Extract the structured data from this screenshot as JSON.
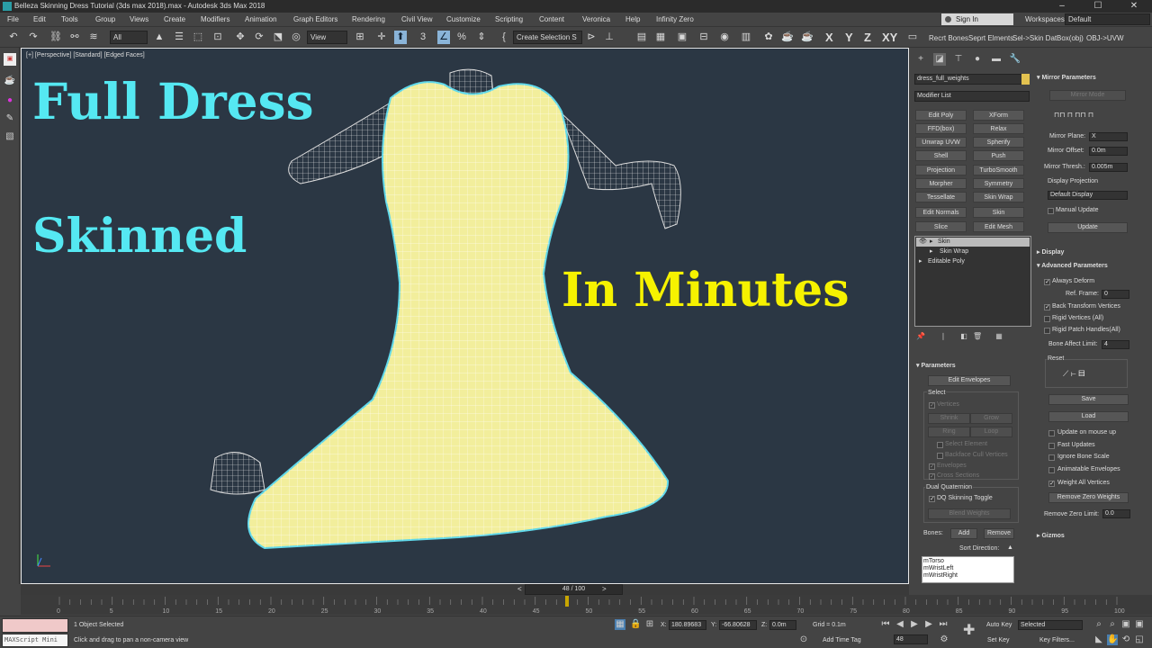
{
  "title": "Belleza Skinning Dress Tutorial (3ds max 2018).max - Autodesk 3ds Max 2018",
  "menu": [
    "File",
    "Edit",
    "Tools",
    "Group",
    "Views",
    "Create",
    "Modifiers",
    "Animation",
    "Graph Editors",
    "Rendering",
    "Civil View",
    "Customize",
    "Scripting",
    "Content",
    "Veronica",
    "Help",
    "Infinity Zero"
  ],
  "signin": "Sign In",
  "workspaces_label": "Workspaces:",
  "workspace": "Default",
  "toolbar": {
    "filter": "All",
    "view": "View",
    "selection_set": "Create Selection S",
    "axes": [
      "X",
      "Y",
      "Z",
      "XY"
    ],
    "links": [
      "Recrt Bones",
      "Seprt Elments",
      "Sel->Skin Dat",
      "Box(obj)",
      "OBJ->UVW"
    ]
  },
  "viewport": {
    "label": "[+] [Perspective] [Standard] [Edged Faces]",
    "headline1": "Full Dress",
    "headline2": "Skinned",
    "headline3": "In Minutes",
    "colors": {
      "headline_cyan": "#55e8f2",
      "headline_yellow": "#f6f200",
      "dress": "#f2ee9c",
      "bg": "#2b3744"
    }
  },
  "cmd": {
    "object_name": "dress_full_weights",
    "modifier_list": "Modifier List",
    "modifiers": [
      "Edit Poly",
      "XForm",
      "FFD(box)",
      "Relax",
      "Unwrap UVW",
      "Spherify",
      "Shell",
      "Push",
      "Projection",
      "TurboSmooth",
      "Morpher",
      "Symmetry",
      "Tessellate",
      "Skin Wrap",
      "Edit Normals",
      "Skin",
      "Slice",
      "Edit Mesh"
    ],
    "stack": [
      "Skin",
      "Skin Wrap",
      "Editable Poly"
    ],
    "parameters": {
      "head": "Parameters",
      "edit_envelopes": "Edit Envelopes",
      "select": "Select",
      "vertices": "Vertices",
      "shrink": "Shrink",
      "grow": "Grow",
      "ring": "Ring",
      "loop": "Loop",
      "select_element": "Select Element",
      "backface": "Backface Cull Vertices",
      "envelopes": "Envelopes",
      "cross_sections": "Cross Sections",
      "dq": "Dual Quaternion",
      "dq_toggle": "DQ Skinning Toggle",
      "blend": "Blend Weights",
      "bones": "Bones:",
      "add": "Add",
      "remove": "Remove",
      "sort": "Sort Direction:",
      "bone_list": [
        "mTorso",
        "mWristLeft",
        "mWristRight"
      ]
    },
    "mirror": {
      "head": "Mirror Parameters",
      "mode": "Mirror Mode",
      "plane_label": "Mirror Plane:",
      "plane": "X",
      "offset_label": "Mirror Offset:",
      "offset": "0.0m",
      "thresh_label": "Mirror Thresh.:",
      "thresh": "0.005m",
      "display_projection": "Display Projection",
      "default_display": "Default Display",
      "manual_update": "Manual Update",
      "update": "Update"
    },
    "display_head": "Display",
    "advanced": {
      "head": "Advanced Parameters",
      "always_deform": "Always Deform",
      "ref_frame_label": "Ref. Frame:",
      "ref_frame": "0",
      "back_transform": "Back Transform Vertices",
      "rigid_vertices": "Rigid Vertices (All)",
      "rigid_patch": "Rigid Patch Handles(All)",
      "bone_affect_label": "Bone Affect Limit:",
      "bone_affect": "4",
      "reset": "Reset",
      "save": "Save",
      "load": "Load",
      "update_mouse": "Update on mouse up",
      "fast_updates": "Fast Updates",
      "ignore_bone_scale": "Ignore Bone Scale",
      "animatable_env": "Animatable Envelopes",
      "weight_all": "Weight All Vertices",
      "remove_zero": "Remove Zero Weights",
      "remove_zero_limit_label": "Remove Zero Limit:",
      "remove_zero_limit": "0.0"
    },
    "gizmos_head": "Gizmos"
  },
  "timeline": {
    "frame": "48 / 100",
    "ticks": [
      "0",
      "5",
      "10",
      "15",
      "20",
      "25",
      "30",
      "35",
      "40",
      "45",
      "50",
      "55",
      "60",
      "65",
      "70",
      "75",
      "80",
      "85",
      "90",
      "95",
      "100"
    ],
    "current": 48,
    "total": 100
  },
  "status": {
    "maxscript": "MAXScript Mini",
    "selected": "1 Object Selected",
    "hint": "Click and drag to pan a non-camera view",
    "x_label": "X:",
    "x": "180.89683",
    "y_label": "Y:",
    "y": "-66.80628",
    "z_label": "Z:",
    "z": "0.0m",
    "grid": "Grid = 0.1m",
    "add_time_tag": "Add Time Tag",
    "frame_field": "48",
    "auto_key": "Auto Key",
    "set_key": "Set Key",
    "key_mode": "Selected",
    "key_filters": "Key Filters..."
  }
}
